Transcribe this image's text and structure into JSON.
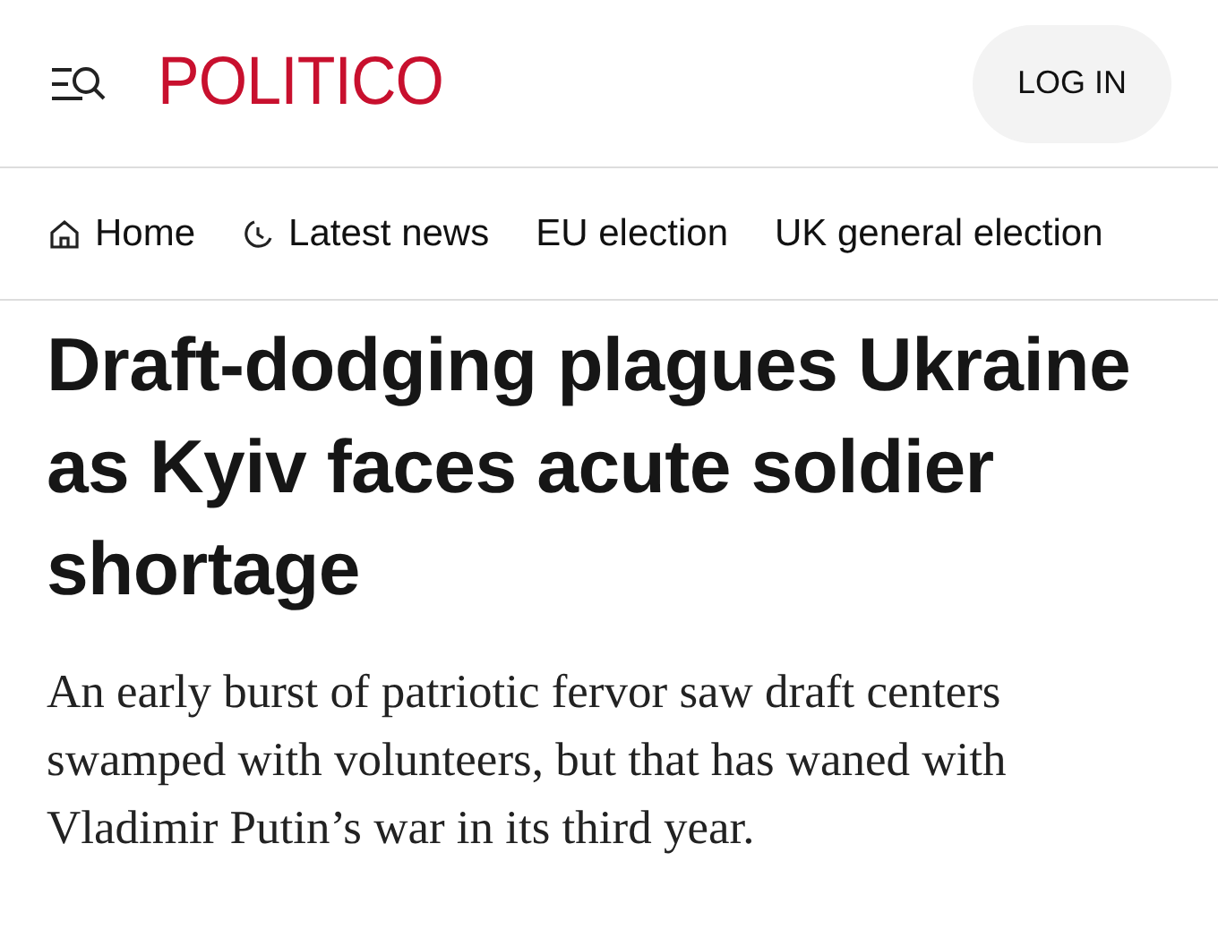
{
  "header": {
    "logo": "POLITICO",
    "login_button": "LOG IN"
  },
  "nav": [
    {
      "label": "Home",
      "kind": "home"
    },
    {
      "label": "Latest news",
      "kind": "clock"
    },
    {
      "label": "EU election",
      "kind": "plain"
    },
    {
      "label": "UK general election",
      "kind": "plain"
    }
  ],
  "article": {
    "headline": "Draft-dodging plagues Ukraine as Kyiv faces acute soldier shortage",
    "dek": "An early burst of patriotic fervor saw draft centers swamped with volunteers, but that has waned with Vladimir Putin’s war in its third year."
  }
}
